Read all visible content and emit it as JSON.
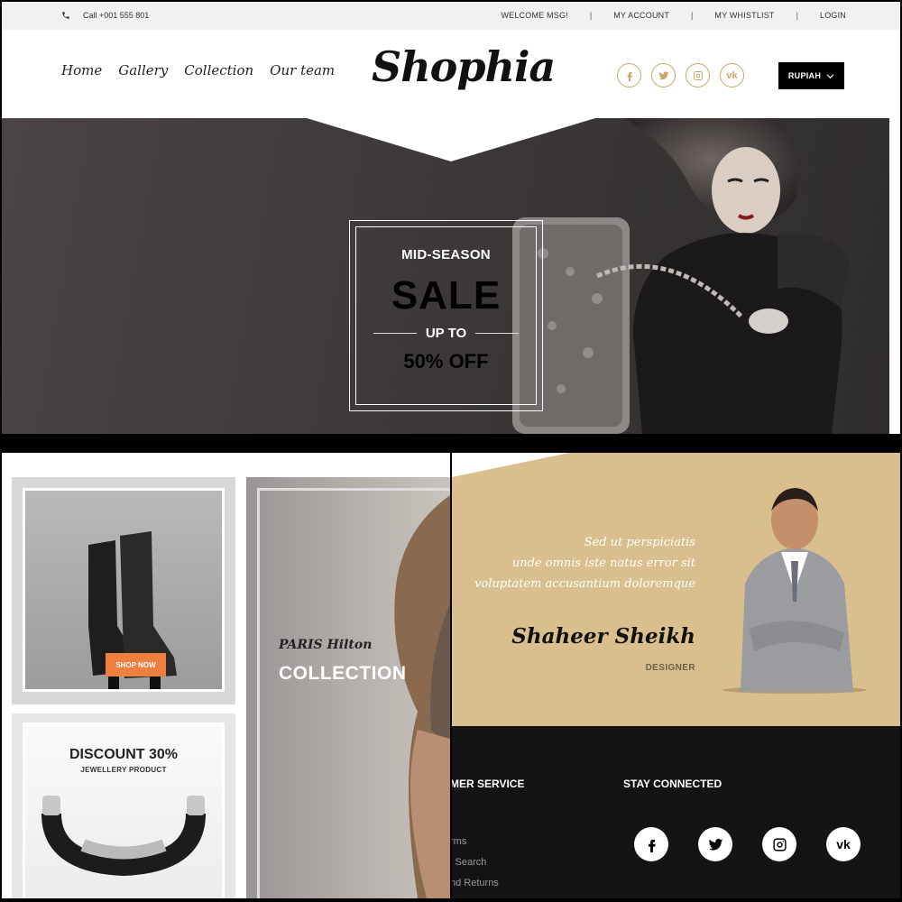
{
  "topbar": {
    "phone": "Call +001 555 801",
    "links": [
      "WELCOME MSG!",
      "MY ACCOUNT",
      "MY WHISTLIST",
      "LOGIN"
    ]
  },
  "nav": {
    "items": [
      "Home",
      "Gallery",
      "Collection",
      "Our team"
    ]
  },
  "brand": {
    "logo": "Shophia"
  },
  "header_socials": [
    "facebook-icon",
    "twitter-icon",
    "instagram-icon",
    "vk-icon"
  ],
  "currency": {
    "label": "RUPIAH"
  },
  "hero": {
    "line1": "MID-SEASON",
    "line2": "SALE",
    "line3": "UP TO",
    "line4": "50% OFF"
  },
  "promo": {
    "shop_now": "SHOP NOW",
    "discount": "DISCOUNT 30%",
    "discount_sub": "JEWELLERY PRODUCT",
    "paris": "PARIS Hilton",
    "collection": "COLLECTION"
  },
  "testimonial": {
    "quote_lines": [
      "Sed ut perspiciatis",
      "unde omnis iste natus error sit",
      "voluptatem accusantium doloremque"
    ],
    "name": "Shaheer Sheikh",
    "role": "DESIGNER"
  },
  "footer": {
    "service_heading": "MER SERVICE",
    "service_links": [
      "rms",
      "l Search",
      "nd Returns"
    ],
    "connected_heading": "STAY CONNECTED",
    "socials": [
      "facebook-icon",
      "twitter-icon",
      "instagram-icon",
      "vk-icon"
    ]
  },
  "colors": {
    "accent": "#c9a66b",
    "orange": "#ef7f3e",
    "tan": "#d9bf8e",
    "dark": "#141414"
  }
}
